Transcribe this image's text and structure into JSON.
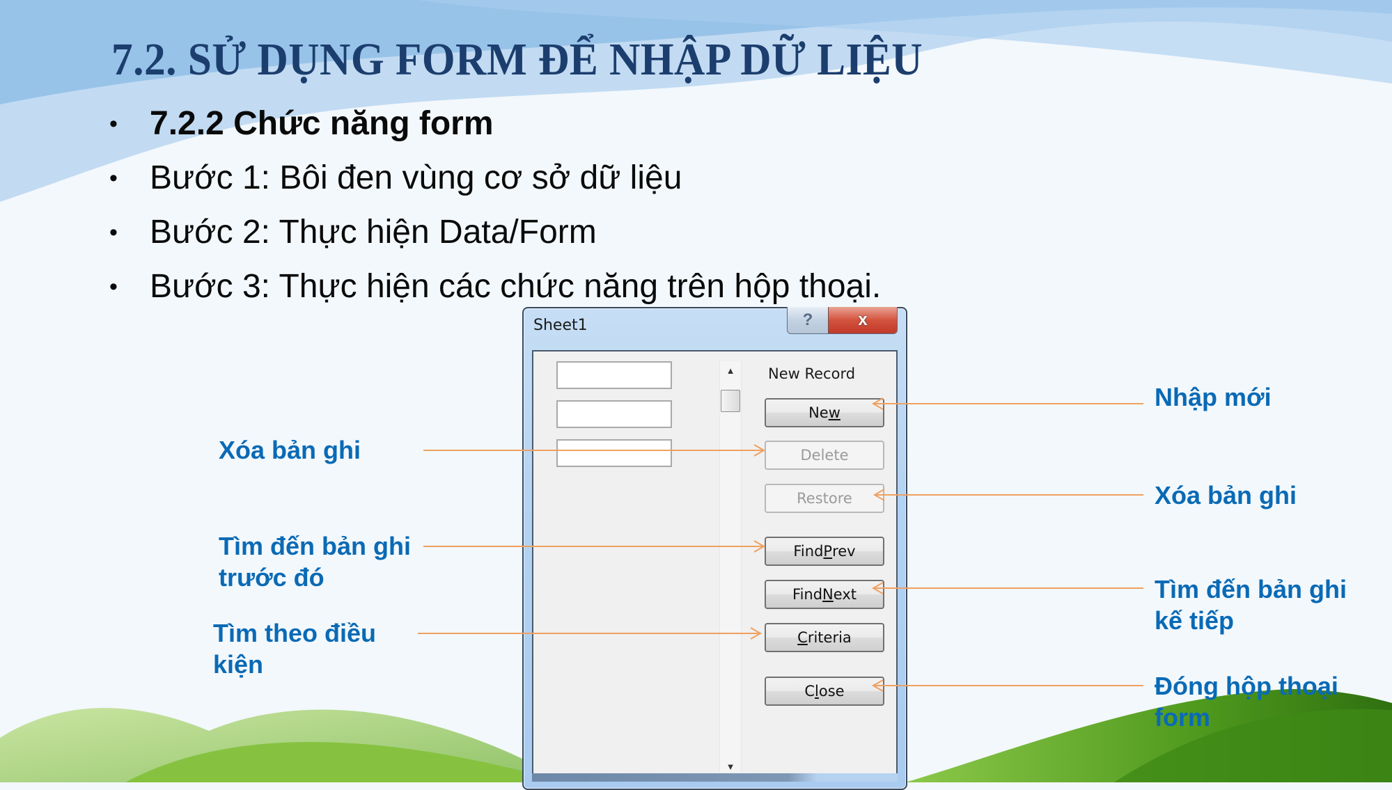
{
  "slide": {
    "title": "7.2. SỬ DỤNG FORM ĐỂ NHẬP DỮ LIỆU",
    "bullets": [
      {
        "text": "7.2.2 Chức năng form",
        "bold": true
      },
      {
        "text": "Bước 1: Bôi đen vùng cơ sở dữ liệu",
        "bold": false
      },
      {
        "text": "Bước 2: Thực hiện Data/Form",
        "bold": false
      },
      {
        "text": "Bước 3: Thực hiện các chức năng trên hộp thoại.",
        "bold": false
      }
    ],
    "bullet_glyph": "•",
    "colors": {
      "title": "#1c3e6e",
      "label": "#0a6ab5",
      "arrow": "#f0a060"
    }
  },
  "annotations": {
    "left": [
      {
        "lines": [
          "Xóa bản ghi"
        ],
        "target": "delete"
      },
      {
        "lines": [
          "Tìm đến bản ghi",
          "trước đó"
        ],
        "target": "find_prev"
      },
      {
        "lines": [
          "Tìm theo điều",
          "kiện"
        ],
        "target": "criteria"
      }
    ],
    "right": [
      {
        "lines": [
          "Nhập mới"
        ],
        "target": "new"
      },
      {
        "lines": [
          "Xóa bản ghi"
        ],
        "target": "restore"
      },
      {
        "lines": [
          "Tìm đến bản ghi",
          "kế tiếp"
        ],
        "target": "find_next"
      },
      {
        "lines": [
          "Đóng hộp thoại",
          "form"
        ],
        "target": "close"
      }
    ]
  },
  "dialog": {
    "title": "Sheet1",
    "help_glyph": "?",
    "close_glyph": "x",
    "record_label": "New Record",
    "fields": [
      {
        "value": ""
      },
      {
        "value": ""
      },
      {
        "value": ""
      }
    ],
    "scroll_up_glyph": "▲",
    "scroll_down_glyph": "▼",
    "buttons": {
      "new": {
        "pre": "Ne",
        "acc": "w",
        "post": "",
        "enabled": true
      },
      "delete": {
        "pre": "Delete",
        "acc": "",
        "post": "",
        "enabled": false
      },
      "restore": {
        "pre": "Restore",
        "acc": "",
        "post": "",
        "enabled": false
      },
      "find_prev": {
        "pre": "Find ",
        "acc": "P",
        "post": "rev",
        "enabled": true
      },
      "find_next": {
        "pre": "Find ",
        "acc": "N",
        "post": "ext",
        "enabled": true
      },
      "criteria": {
        "pre": "",
        "acc": "C",
        "post": "riteria",
        "enabled": true
      },
      "close": {
        "pre": "C",
        "acc": "l",
        "post": "ose",
        "enabled": true
      }
    }
  }
}
